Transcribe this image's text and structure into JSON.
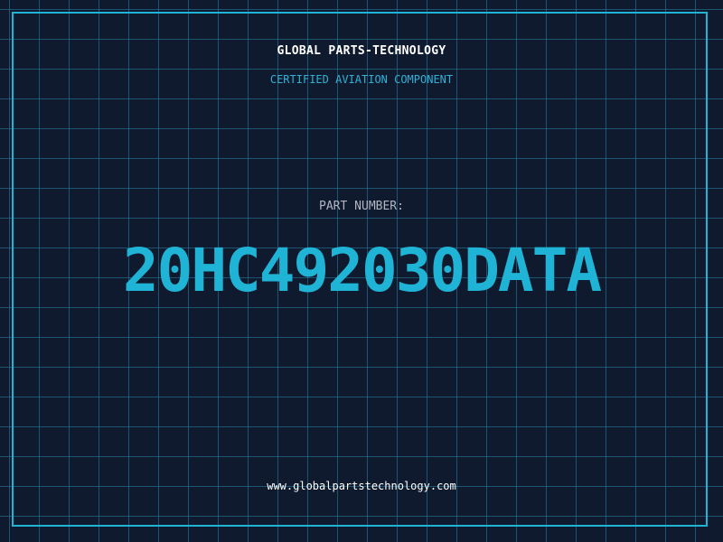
{
  "header": {
    "company": "GLOBAL PARTS-TECHNOLOGY",
    "subtitle": "CERTIFIED AVIATION COMPONENT"
  },
  "part": {
    "label": "PART NUMBER:",
    "number": "20HC492030DATA"
  },
  "footer": {
    "website": "www.globalpartstechnology.com"
  },
  "colors": {
    "background": "#101a2e",
    "grid": "#2882a5",
    "accent": "#1fb3d6",
    "label": "#b0b6c2",
    "text": "#ffffff"
  }
}
